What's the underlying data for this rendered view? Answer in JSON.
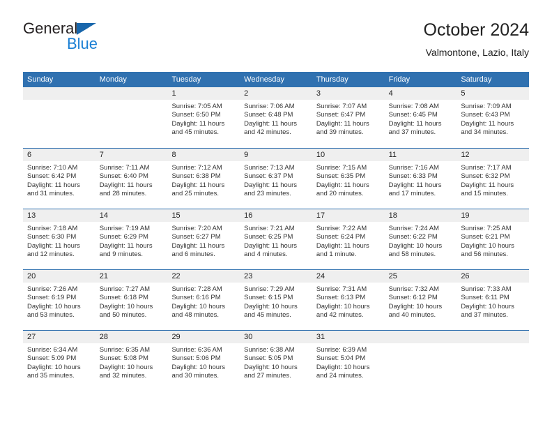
{
  "brand": {
    "name_part1": "General",
    "name_part2": "Blue",
    "triangle_color": "#1866ab",
    "blue_color": "#1a7fd4"
  },
  "header": {
    "title": "October 2024",
    "subtitle": "Valmontone, Lazio, Italy"
  },
  "theme": {
    "header_blue": "#3071b0",
    "day_band_gray": "#efefef",
    "row_divider": "#2f6fae"
  },
  "weekdays": [
    "Sunday",
    "Monday",
    "Tuesday",
    "Wednesday",
    "Thursday",
    "Friday",
    "Saturday"
  ],
  "weeks": [
    [
      {
        "day": "",
        "sunrise": "",
        "sunset": "",
        "daylight": "",
        "empty": true
      },
      {
        "day": "",
        "sunrise": "",
        "sunset": "",
        "daylight": "",
        "empty": true
      },
      {
        "day": "1",
        "sunrise": "Sunrise: 7:05 AM",
        "sunset": "Sunset: 6:50 PM",
        "daylight": "Daylight: 11 hours and 45 minutes."
      },
      {
        "day": "2",
        "sunrise": "Sunrise: 7:06 AM",
        "sunset": "Sunset: 6:48 PM",
        "daylight": "Daylight: 11 hours and 42 minutes."
      },
      {
        "day": "3",
        "sunrise": "Sunrise: 7:07 AM",
        "sunset": "Sunset: 6:47 PM",
        "daylight": "Daylight: 11 hours and 39 minutes."
      },
      {
        "day": "4",
        "sunrise": "Sunrise: 7:08 AM",
        "sunset": "Sunset: 6:45 PM",
        "daylight": "Daylight: 11 hours and 37 minutes."
      },
      {
        "day": "5",
        "sunrise": "Sunrise: 7:09 AM",
        "sunset": "Sunset: 6:43 PM",
        "daylight": "Daylight: 11 hours and 34 minutes."
      }
    ],
    [
      {
        "day": "6",
        "sunrise": "Sunrise: 7:10 AM",
        "sunset": "Sunset: 6:42 PM",
        "daylight": "Daylight: 11 hours and 31 minutes."
      },
      {
        "day": "7",
        "sunrise": "Sunrise: 7:11 AM",
        "sunset": "Sunset: 6:40 PM",
        "daylight": "Daylight: 11 hours and 28 minutes."
      },
      {
        "day": "8",
        "sunrise": "Sunrise: 7:12 AM",
        "sunset": "Sunset: 6:38 PM",
        "daylight": "Daylight: 11 hours and 25 minutes."
      },
      {
        "day": "9",
        "sunrise": "Sunrise: 7:13 AM",
        "sunset": "Sunset: 6:37 PM",
        "daylight": "Daylight: 11 hours and 23 minutes."
      },
      {
        "day": "10",
        "sunrise": "Sunrise: 7:15 AM",
        "sunset": "Sunset: 6:35 PM",
        "daylight": "Daylight: 11 hours and 20 minutes."
      },
      {
        "day": "11",
        "sunrise": "Sunrise: 7:16 AM",
        "sunset": "Sunset: 6:33 PM",
        "daylight": "Daylight: 11 hours and 17 minutes."
      },
      {
        "day": "12",
        "sunrise": "Sunrise: 7:17 AM",
        "sunset": "Sunset: 6:32 PM",
        "daylight": "Daylight: 11 hours and 15 minutes."
      }
    ],
    [
      {
        "day": "13",
        "sunrise": "Sunrise: 7:18 AM",
        "sunset": "Sunset: 6:30 PM",
        "daylight": "Daylight: 11 hours and 12 minutes."
      },
      {
        "day": "14",
        "sunrise": "Sunrise: 7:19 AM",
        "sunset": "Sunset: 6:29 PM",
        "daylight": "Daylight: 11 hours and 9 minutes."
      },
      {
        "day": "15",
        "sunrise": "Sunrise: 7:20 AM",
        "sunset": "Sunset: 6:27 PM",
        "daylight": "Daylight: 11 hours and 6 minutes."
      },
      {
        "day": "16",
        "sunrise": "Sunrise: 7:21 AM",
        "sunset": "Sunset: 6:25 PM",
        "daylight": "Daylight: 11 hours and 4 minutes."
      },
      {
        "day": "17",
        "sunrise": "Sunrise: 7:22 AM",
        "sunset": "Sunset: 6:24 PM",
        "daylight": "Daylight: 11 hours and 1 minute."
      },
      {
        "day": "18",
        "sunrise": "Sunrise: 7:24 AM",
        "sunset": "Sunset: 6:22 PM",
        "daylight": "Daylight: 10 hours and 58 minutes."
      },
      {
        "day": "19",
        "sunrise": "Sunrise: 7:25 AM",
        "sunset": "Sunset: 6:21 PM",
        "daylight": "Daylight: 10 hours and 56 minutes."
      }
    ],
    [
      {
        "day": "20",
        "sunrise": "Sunrise: 7:26 AM",
        "sunset": "Sunset: 6:19 PM",
        "daylight": "Daylight: 10 hours and 53 minutes."
      },
      {
        "day": "21",
        "sunrise": "Sunrise: 7:27 AM",
        "sunset": "Sunset: 6:18 PM",
        "daylight": "Daylight: 10 hours and 50 minutes."
      },
      {
        "day": "22",
        "sunrise": "Sunrise: 7:28 AM",
        "sunset": "Sunset: 6:16 PM",
        "daylight": "Daylight: 10 hours and 48 minutes."
      },
      {
        "day": "23",
        "sunrise": "Sunrise: 7:29 AM",
        "sunset": "Sunset: 6:15 PM",
        "daylight": "Daylight: 10 hours and 45 minutes."
      },
      {
        "day": "24",
        "sunrise": "Sunrise: 7:31 AM",
        "sunset": "Sunset: 6:13 PM",
        "daylight": "Daylight: 10 hours and 42 minutes."
      },
      {
        "day": "25",
        "sunrise": "Sunrise: 7:32 AM",
        "sunset": "Sunset: 6:12 PM",
        "daylight": "Daylight: 10 hours and 40 minutes."
      },
      {
        "day": "26",
        "sunrise": "Sunrise: 7:33 AM",
        "sunset": "Sunset: 6:11 PM",
        "daylight": "Daylight: 10 hours and 37 minutes."
      }
    ],
    [
      {
        "day": "27",
        "sunrise": "Sunrise: 6:34 AM",
        "sunset": "Sunset: 5:09 PM",
        "daylight": "Daylight: 10 hours and 35 minutes."
      },
      {
        "day": "28",
        "sunrise": "Sunrise: 6:35 AM",
        "sunset": "Sunset: 5:08 PM",
        "daylight": "Daylight: 10 hours and 32 minutes."
      },
      {
        "day": "29",
        "sunrise": "Sunrise: 6:36 AM",
        "sunset": "Sunset: 5:06 PM",
        "daylight": "Daylight: 10 hours and 30 minutes."
      },
      {
        "day": "30",
        "sunrise": "Sunrise: 6:38 AM",
        "sunset": "Sunset: 5:05 PM",
        "daylight": "Daylight: 10 hours and 27 minutes."
      },
      {
        "day": "31",
        "sunrise": "Sunrise: 6:39 AM",
        "sunset": "Sunset: 5:04 PM",
        "daylight": "Daylight: 10 hours and 24 minutes."
      },
      {
        "day": "",
        "sunrise": "",
        "sunset": "",
        "daylight": "",
        "empty": true
      },
      {
        "day": "",
        "sunrise": "",
        "sunset": "",
        "daylight": "",
        "empty": true
      }
    ]
  ]
}
